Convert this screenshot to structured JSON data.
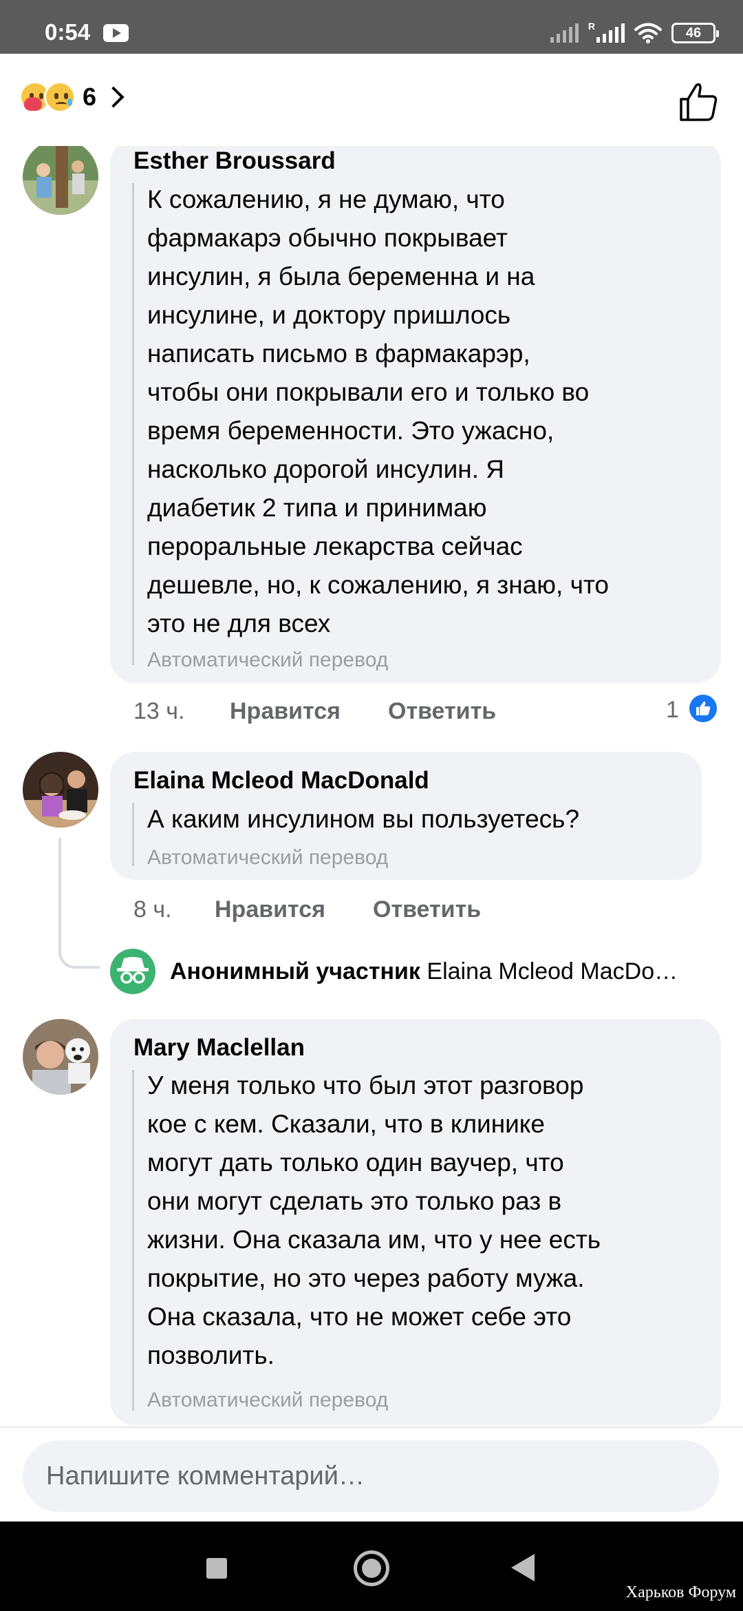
{
  "status_bar": {
    "time": "0:54",
    "roaming_label": "R",
    "battery_level": "46",
    "icons": [
      "youtube-icon",
      "signal-icon",
      "signal-roaming-icon",
      "wifi-icon",
      "battery-icon"
    ]
  },
  "header": {
    "reaction_count": "6",
    "reaction_icons": [
      "care-reaction-icon",
      "sad-reaction-icon"
    ],
    "like_icon": "thumbs-up-icon"
  },
  "comments": [
    {
      "author": "Esther Broussard",
      "text": "К сожалению, я не думаю, что\nфармакарэ обычно покрывает\nинсулин, я была беременна и на\nинсулине, и доктору пришлось\nнаписать письмо в фармакарэр,\nчтобы они покрывали его и только во\nвремя беременности. Это ужасно,\nнасколько дорогой инсулин. Я\nдиабетик 2 типа и принимаю\nпероральные лекарства сейчас\nдешевле, но, к сожалению, я знаю, что\nэто не для всех",
      "translation_label": "Автоматический перевод",
      "time": "13 ч.",
      "like_label": "Нравится",
      "reply_label": "Ответить",
      "likes": "1"
    },
    {
      "author": "Elaina Mcleod MacDonald",
      "text": "А каким инсулином вы пользуетесь?",
      "translation_label": "Автоматический перевод",
      "time": "8 ч.",
      "like_label": "Нравится",
      "reply_label": "Ответить"
    },
    {
      "author": "Mary Maclellan",
      "text": "У меня только что был этот разговор\nкое с кем. Сказали, что в клинике\nмогут дать только один ваучер, что\nони могут сделать это только раз в\nжизни. Она сказала им, что у нее есть\nпокрытие, но это через работу мужа.\nОна сказала, что не может себе это\nпозволить.",
      "translation_label": "Автоматический перевод"
    }
  ],
  "reply_preview": {
    "author": "Анонимный участник",
    "reply_to": "Elaina Mcleod MacDo…"
  },
  "composer": {
    "placeholder": "Напишите комментарий…"
  },
  "watermark": "Харьков Форум",
  "colors": {
    "bubble": "#f0f2f5",
    "meta_text": "#65676b",
    "like_blue": "#1877f2",
    "status_bar": "#5b5b5b"
  }
}
